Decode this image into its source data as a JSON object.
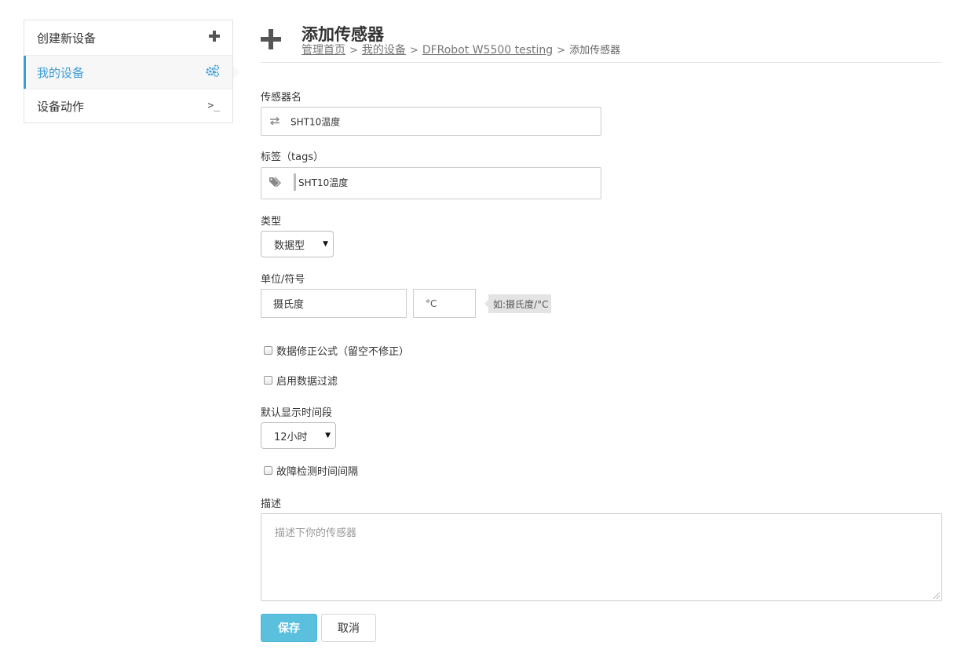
{
  "sidebar": {
    "items": [
      {
        "label": "创建新设备",
        "icon": "plus-icon",
        "glyph": "✚",
        "active": false
      },
      {
        "label": "我的设备",
        "icon": "gears-icon",
        "glyph": "⚙",
        "active": true
      },
      {
        "label": "设备动作",
        "icon": "terminal-icon",
        "glyph": ">_",
        "active": false
      }
    ]
  },
  "header": {
    "icon": "plus-icon",
    "title": "添加传感器",
    "breadcrumb": {
      "home": "管理首页",
      "devices": "我的设备",
      "device": "DFRobot W5500 testing",
      "current": "添加传感器",
      "separator": ">"
    }
  },
  "form": {
    "sensor_name_label": "传感器名",
    "sensor_name_value": "SHT10温度",
    "sensor_name_icon": "exchange-icon",
    "tags_label": "标签（tags）",
    "tags_value": "SHT10温度",
    "tags_icon": "tags-icon",
    "type_label": "类型",
    "type_value": "数据型",
    "unit_label": "单位/符号",
    "unit_name_value": "摄氏度",
    "unit_symbol_value": "°C",
    "unit_hint": "如:摄氏度/°C",
    "checkbox_formula": "数据修正公式（留空不修正）",
    "checkbox_filter": "启用数据过滤",
    "period_label": "默认显示时间段",
    "period_value": "12小时",
    "checkbox_fault": "故障检测时间间隔",
    "description_label": "描述",
    "description_placeholder": "描述下你的传感器"
  },
  "buttons": {
    "save": "保存",
    "cancel": "取消"
  },
  "colors": {
    "accent": "#3b9cd6",
    "save_button": "#5bc0de"
  }
}
